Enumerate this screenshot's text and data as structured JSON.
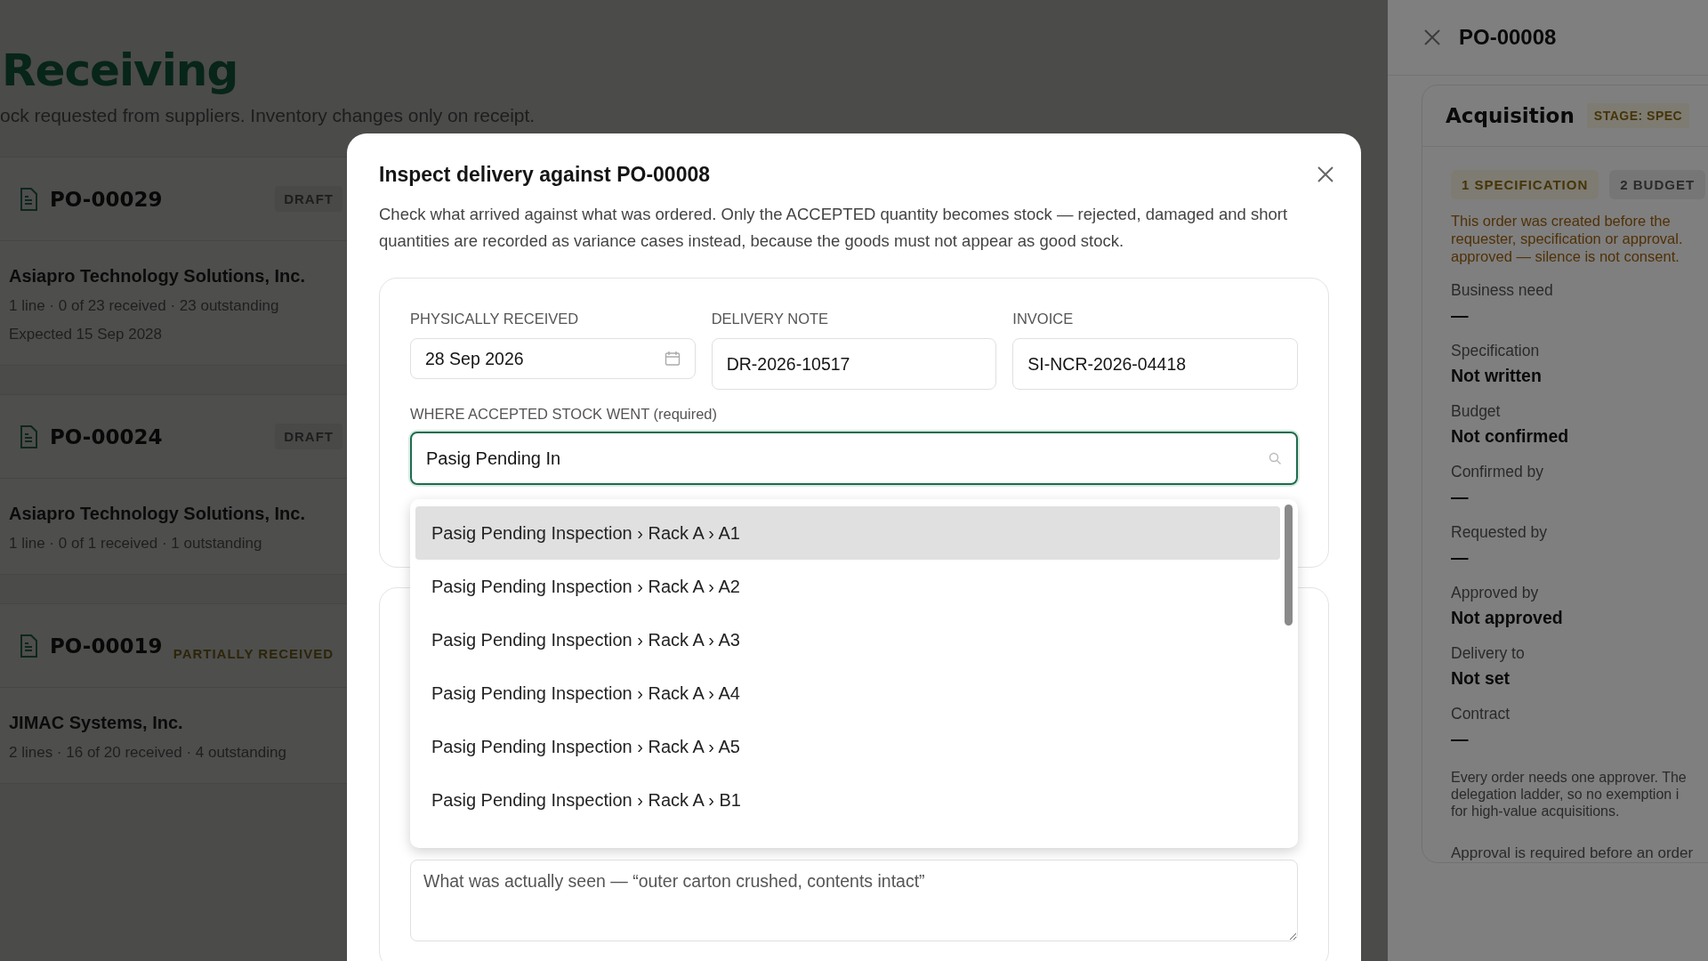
{
  "page": {
    "title": "Receiving",
    "subtitle": "ock requested from suppliers. Inventory changes only on receipt."
  },
  "orders": [
    {
      "number": "PO-00029",
      "status": "DRAFT",
      "kind": "draft",
      "supplier": "Asiapro Technology Solutions, Inc.",
      "summary": "1 line · 0 of 23 received · 23 outstanding",
      "expected": "Expected 15 Sep 2028"
    },
    {
      "number": "PO-00024",
      "status": "DRAFT",
      "kind": "draft",
      "supplier": "Asiapro Technology Solutions, Inc.",
      "summary": "1 line · 0 of 1 received · 1 outstanding"
    },
    {
      "number": "PO-00019",
      "status": "PARTIALLY RECEIVED",
      "kind": "partial",
      "supplier": "JIMAC Systems, Inc.",
      "summary": "2 lines · 16 of 20 received · 4 outstanding"
    }
  ],
  "drawer": {
    "title": "PO-00008",
    "section": "Acquisition",
    "stage": "STAGE: SPEC",
    "steps": [
      {
        "label": "1 SPECIFICATION",
        "selected": true
      },
      {
        "label": "2 BUDGET",
        "selected": false
      }
    ],
    "warning": [
      "This order was created before the",
      "requester, specification or approval.",
      "approved — silence is not consent."
    ],
    "fields": [
      {
        "label": "Business need",
        "value": "—"
      },
      {
        "label": "Specification",
        "value": "Not written"
      },
      {
        "label": "Budget",
        "value": "Not confirmed"
      },
      {
        "label": "Confirmed by",
        "value": "—"
      },
      {
        "label": "Requested by",
        "value": "—"
      },
      {
        "label": "Approved by",
        "value": "Not approved"
      },
      {
        "label": "Delivery to",
        "value": "Not set"
      },
      {
        "label": "Contract",
        "value": "—"
      }
    ],
    "note": [
      "Every order needs one approver. The",
      "delegation ladder, so no exemption i",
      "for high-value acquisitions."
    ],
    "footer": "Approval is required before an order"
  },
  "modal": {
    "title": "Inspect delivery against PO-00008",
    "description": "Check what arrived against what was ordered. Only the ACCEPTED quantity becomes stock — rejected, damaged and short quantities are recorded as variance cases instead, because the goods must not appear as good stock.",
    "fields": [
      {
        "label": "PHYSICALLY RECEIVED",
        "value": "28 Sep 2026",
        "kind": "date"
      },
      {
        "label": "DELIVERY NOTE",
        "value": "DR-2026-10517",
        "kind": "text"
      },
      {
        "label": "INVOICE",
        "value": "SI-NCR-2026-04418",
        "kind": "text"
      }
    ],
    "location": {
      "label": "WHERE ACCEPTED STOCK WENT (required)",
      "value": "Pasig Pending In"
    },
    "options": [
      {
        "label": "Pasig Pending Inspection › Rack A › A1",
        "selected": true
      },
      {
        "label": "Pasig Pending Inspection › Rack A › A2",
        "selected": false
      },
      {
        "label": "Pasig Pending Inspection › Rack A › A3",
        "selected": false
      },
      {
        "label": "Pasig Pending Inspection › Rack A › A4",
        "selected": false
      },
      {
        "label": "Pasig Pending Inspection › Rack A › A5",
        "selected": false
      },
      {
        "label": "Pasig Pending Inspection › Rack A › B1",
        "selected": false
      }
    ],
    "notes": {
      "placeholder": "What was actually seen — “outer carton crushed, contents intact”"
    }
  }
}
